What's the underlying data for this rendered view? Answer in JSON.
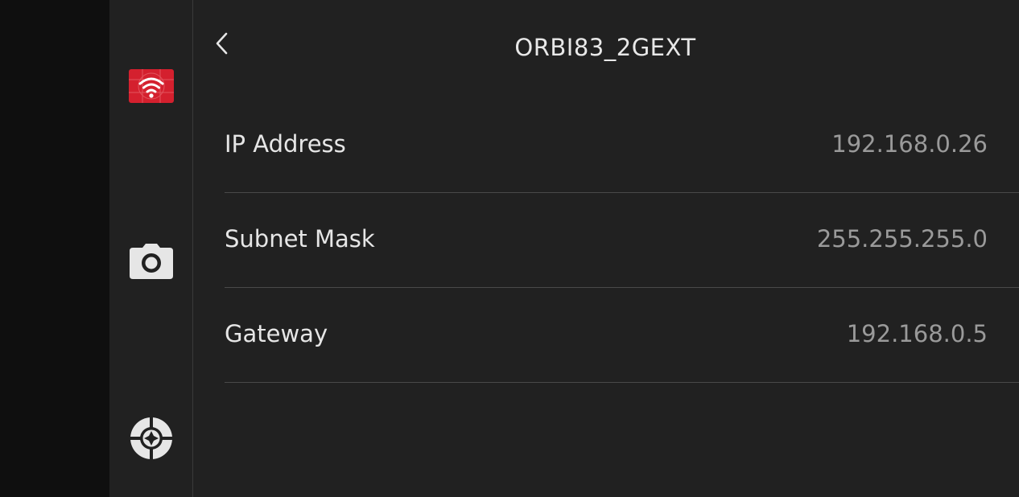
{
  "header": {
    "title": "ORBI83_2GEXT",
    "back_icon": "chevron-left-icon"
  },
  "sidebar": {
    "items": [
      {
        "icon": "wifi-icon",
        "active": true,
        "accent": "#d4202e"
      },
      {
        "icon": "camera-icon",
        "active": false
      },
      {
        "icon": "target-icon",
        "active": false
      }
    ]
  },
  "network_info": {
    "rows": [
      {
        "label": "IP Address",
        "value": "192.168.0.26"
      },
      {
        "label": "Subnet Mask",
        "value": "255.255.255.0"
      },
      {
        "label": "Gateway",
        "value": "192.168.0.5"
      }
    ]
  },
  "colors": {
    "background": "#212121",
    "gutter": "#0f0f0f",
    "label": "#e6e6e6",
    "value": "#9a9a9a",
    "accent": "#d4202e"
  }
}
